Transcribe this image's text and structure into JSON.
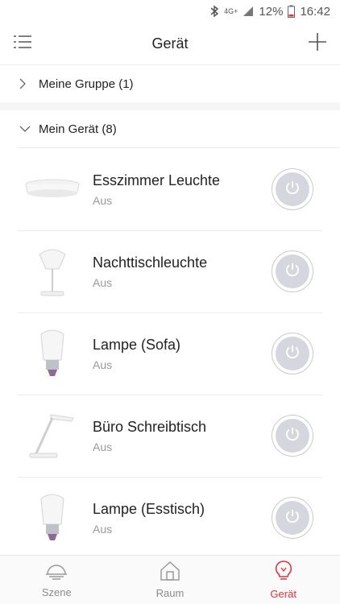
{
  "status_bar": {
    "network": "4G+",
    "battery": "12%",
    "time": "16:42"
  },
  "header": {
    "title": "Gerät"
  },
  "groups": {
    "collapsed_label": "Meine Gruppe (1)",
    "expanded_label": "Mein Gerät (8)"
  },
  "devices": [
    {
      "name": "Esszimmer Leuchte",
      "status": "Aus",
      "icon": "ceiling-light-icon"
    },
    {
      "name": "Nachttischleuchte",
      "status": "Aus",
      "icon": "table-lamp-icon"
    },
    {
      "name": "Lampe (Sofa)",
      "status": "Aus",
      "icon": "bulb-icon"
    },
    {
      "name": "Büro Schreibtisch",
      "status": "Aus",
      "icon": "desk-lamp-icon"
    },
    {
      "name": "Lampe (Esstisch)",
      "status": "Aus",
      "icon": "bulb-icon"
    }
  ],
  "tabs": [
    {
      "label": "Szene",
      "icon": "scene-icon"
    },
    {
      "label": "Raum",
      "icon": "house-icon"
    },
    {
      "label": "Gerät",
      "icon": "bulb-outline-icon"
    }
  ],
  "colors": {
    "accent": "#e0333b",
    "power_off": "#d5d6de"
  }
}
